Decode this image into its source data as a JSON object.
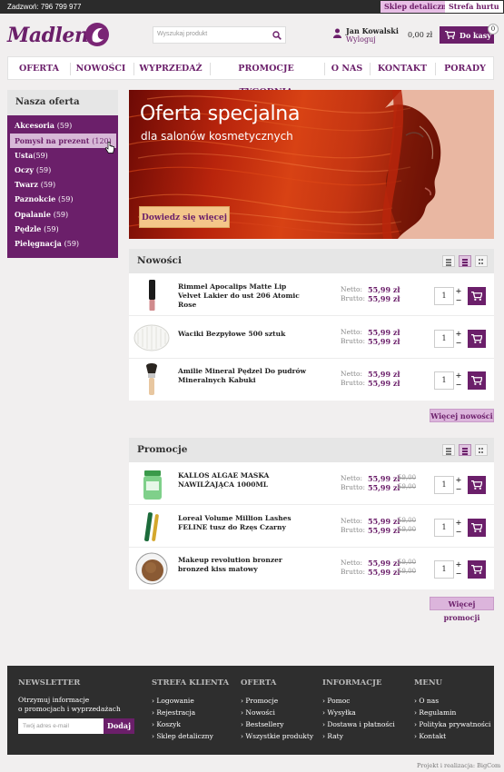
{
  "topbar": {
    "phone": "Zadzwoń: 796 799 977",
    "retail": "Sklep detaliczny",
    "wholesale": "Strefa hurtu"
  },
  "header": {
    "logo": "Madlen",
    "search_placeholder": "Wyszukaj produkt",
    "user_name": "Jan Kowalski",
    "logout": "Wyloguj",
    "cart_total": "0,00 zł",
    "cart_button": "Do kasy",
    "cart_count": "0"
  },
  "nav": [
    "OFERTA",
    "NOWOŚCI",
    "WYPRZEDAŻ",
    "PROMOCJE TYGODNIA",
    "O NAS",
    "KONTAKT",
    "PORADY"
  ],
  "sidebar": {
    "title": "Nasza oferta",
    "items": [
      {
        "label": "Akcesoria",
        "count": "(59)"
      },
      {
        "label": "Pomysł na prezent",
        "count": "(120)"
      },
      {
        "label": "Usta",
        "count": "(59)"
      },
      {
        "label": "Oczy",
        "count": "(59)"
      },
      {
        "label": "Twarz",
        "count": "(59)"
      },
      {
        "label": "Paznokcie",
        "count": "(59)"
      },
      {
        "label": "Opalanie",
        "count": "(59)"
      },
      {
        "label": "Pędzle",
        "count": "(59)"
      },
      {
        "label": "Pielęgnacja",
        "count": "(59)"
      }
    ]
  },
  "banner": {
    "title": "Oferta specjalna",
    "subtitle": "dla salonów kosmetycznych",
    "button": "Dowiedz się więcej"
  },
  "labels": {
    "netto": "Netto:",
    "brutto": "Brutto:",
    "plus": "+",
    "minus": "−"
  },
  "new": {
    "title": "Nowości",
    "more": "Więcej nowości",
    "products": [
      {
        "name": "Rimmel Apocalips Matte Lip Velvet Lakier do ust 206 Atomic Rose",
        "netto": "55,99 zł",
        "brutto": "55,99 zł",
        "qty": "1"
      },
      {
        "name": "Waciki Bezpyłowe 500 sztuk",
        "netto": "55,99 zł",
        "brutto": "55,99 zł",
        "qty": "1"
      },
      {
        "name": "Amilie Mineral Pędzel Do pudrów Mineralnych Kabuki",
        "netto": "55,99 zł",
        "brutto": "55,99 zł",
        "qty": "1"
      }
    ]
  },
  "promo": {
    "title": "Promocje",
    "more": "Więcej promocji",
    "products": [
      {
        "name": "KALLOS ALGAE MASKA NAWILŻAJĄCA 1000ML",
        "netto": "55,99 zł",
        "brutto": "55,99 zł",
        "old_netto": "59,00",
        "old_brutto": "59,00",
        "qty": "1"
      },
      {
        "name": "Loreal Volume Million Lashes FELINE tusz do Rzęs Czarny",
        "netto": "55,99 zł",
        "brutto": "55,99 zł",
        "old_netto": "59,00",
        "old_brutto": "59,00",
        "qty": "1"
      },
      {
        "name": "Makeup revolution bronzer bronzed kiss matowy",
        "netto": "55,99 zł",
        "brutto": "55,99 zł",
        "old_netto": "59,00",
        "old_brutto": "59,00",
        "qty": "1"
      }
    ]
  },
  "footer": {
    "newsletter": {
      "title": "NEWSLETTER",
      "text1": "Otrzymuj informacje",
      "text2": "o promocjach i wyprzedażach",
      "placeholder": "Twój adres e-mail",
      "button": "Dodaj"
    },
    "columns": [
      {
        "title": "STREFA KLIENTA",
        "items": [
          "Logowanie",
          "Rejestracja",
          "Koszyk",
          "Sklep detaliczny"
        ]
      },
      {
        "title": "OFERTA",
        "items": [
          "Promocje",
          "Nowości",
          "Bestsellery",
          "Wszystkie produkty"
        ]
      },
      {
        "title": "INFORMACJE",
        "items": [
          "Pomoc",
          "Wysyłka",
          "Dostawa i płatności",
          "Raty"
        ]
      },
      {
        "title": "MENU",
        "items": [
          "O nas",
          "Regulamin",
          "Polityka prywatności",
          "Kontakt"
        ]
      }
    ]
  },
  "credits": "Projekt i realizacja: BigCom",
  "colors": {
    "brand": "#6b1f6a",
    "brand_light": "#dcb5dc",
    "dark": "#2e2e2e"
  }
}
